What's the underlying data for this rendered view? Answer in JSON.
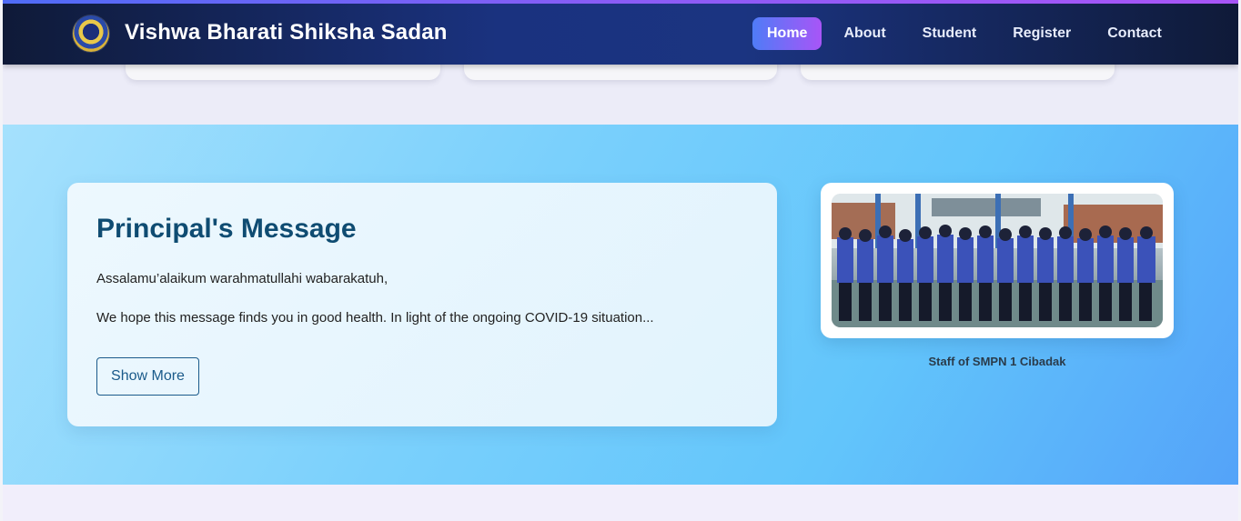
{
  "header": {
    "brand": "Vishwa Bharati Shiksha Sadan",
    "nav": [
      {
        "label": "Home",
        "active": true
      },
      {
        "label": "About",
        "active": false
      },
      {
        "label": "Student",
        "active": false
      },
      {
        "label": "Register",
        "active": false
      },
      {
        "label": "Contact",
        "active": false
      }
    ]
  },
  "principal": {
    "title": "Principal's Message",
    "greeting": "Assalamu’alaikum warahmatullahi wabarakatuh,",
    "body": "We hope this message finds you in good health. In light of the ongoing COVID-19 situation...",
    "button": "Show More"
  },
  "photo": {
    "caption": "Staff of SMPN 1 Cibadak"
  },
  "colors": {
    "accent_start": "#4f7cf7",
    "accent_end": "#a855f7",
    "title": "#0f4c72",
    "nav_bg": "#1a327f"
  }
}
